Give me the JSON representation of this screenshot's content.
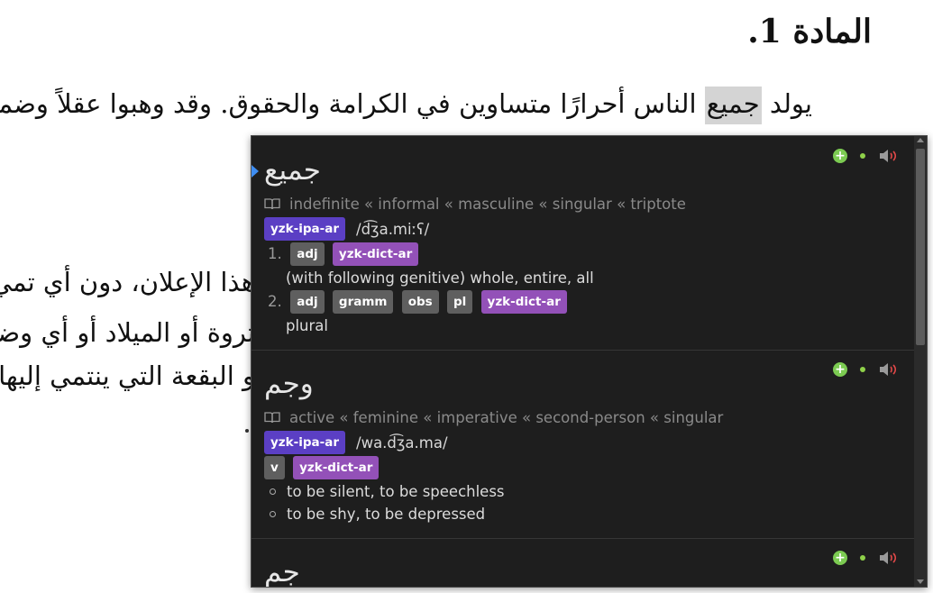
{
  "document": {
    "title": "المادة 1.",
    "paragraph1_pre": "يولد ",
    "paragraph1_hl": "جميع",
    "paragraph1_post": " الناس أحرارًا متساوين في الكرامة والحقوق. وقد وهبوا عقلاً وضميرًا وعليهم",
    "line2": "هذا الإعلان، دون أي تمي",
    "line3": "ثروة أو الميلاد أو أي وضع",
    "line4": "و البقعة التي ينتمي إليها ال"
  },
  "popup": {
    "entries": [
      {
        "term": "جميع",
        "tags": "indefinite « informal « masculine « singular « triptote",
        "ipa_source": "yzk-ipa-ar",
        "ipa": "/d͡ʒa.miːʕ/",
        "senses": [
          {
            "num": "1.",
            "tags": [
              "adj"
            ],
            "dict": "yzk-dict-ar",
            "gloss": "(with following genitive) whole, entire, all"
          },
          {
            "num": "2.",
            "tags": [
              "adj",
              "gramm",
              "obs",
              "pl"
            ],
            "dict": "yzk-dict-ar",
            "gloss": "plural"
          }
        ]
      },
      {
        "term": "وجم",
        "tags": "active « feminine « imperative « second-person « singular",
        "ipa_source": "yzk-ipa-ar",
        "ipa": "/wa.d͡ʒa.ma/",
        "sense_tags": [
          "v"
        ],
        "dict": "yzk-dict-ar",
        "glosses": [
          "to be silent, to be speechless",
          "to be shy, to be depressed"
        ]
      },
      {
        "term": "جم"
      }
    ],
    "icons": {
      "add": "add-note-icon",
      "status": "status-dot-icon",
      "audio": "play-audio-icon"
    }
  },
  "colors": {
    "ipa_badge": "#5b3fc4",
    "dict_tag": "#9351b8",
    "plain_tag": "#5f5f5f",
    "add": "#7ccb52"
  }
}
